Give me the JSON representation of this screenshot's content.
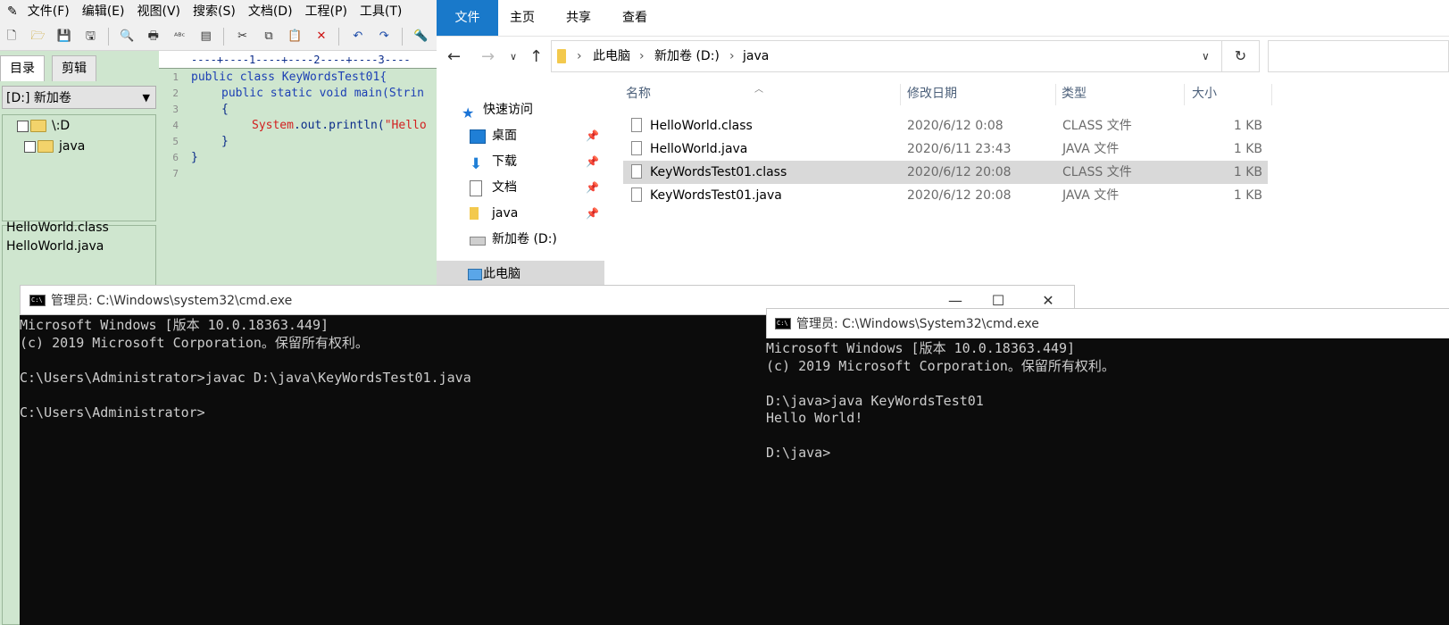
{
  "editor": {
    "menus": [
      "文件(F)",
      "编辑(E)",
      "视图(V)",
      "搜索(S)",
      "文档(D)",
      "工程(P)",
      "工具(T)"
    ],
    "tabs": [
      "目录",
      "剪辑"
    ],
    "drive": "[D:] 新加卷",
    "tree": [
      "\\:D",
      "java"
    ],
    "files": [
      "HelloWorld.class",
      "HelloWorld.java"
    ],
    "ruler": "----+----1----+----2----+----3----",
    "line_numbers": [
      "1",
      "2",
      "3",
      "4",
      "5",
      "6",
      "7"
    ],
    "code": {
      "l1": "public class KeyWordsTest01{",
      "l2_kw": "public static void main(Strin",
      "l3": "{",
      "l4_cls": "System",
      "l4_rest": ".out.println(",
      "l4_str": "\"Hello",
      "l5": "}",
      "l6": "}"
    }
  },
  "explorer": {
    "ribbon_tabs": [
      "文件",
      "主页",
      "共享",
      "查看"
    ],
    "breadcrumb": [
      "此电脑",
      "新加卷 (D:)",
      "java"
    ],
    "nav": [
      {
        "label": "快速访问",
        "icon": "star-icon"
      },
      {
        "label": "桌面",
        "icon": "desktop-icon"
      },
      {
        "label": "下载",
        "icon": "download-icon"
      },
      {
        "label": "文档",
        "icon": "document-icon"
      },
      {
        "label": "java",
        "icon": "folder-icon"
      },
      {
        "label": "新加卷 (D:)",
        "icon": "drive-icon"
      },
      {
        "label": "此电脑",
        "icon": "computer-icon"
      }
    ],
    "columns": [
      "名称",
      "修改日期",
      "类型",
      "大小"
    ],
    "files": [
      {
        "name": "HelloWorld.class",
        "date": "2020/6/12 0:08",
        "type": "CLASS 文件",
        "size": "1 KB"
      },
      {
        "name": "HelloWorld.java",
        "date": "2020/6/11 23:43",
        "type": "JAVA 文件",
        "size": "1 KB"
      },
      {
        "name": "KeyWordsTest01.class",
        "date": "2020/6/12 20:08",
        "type": "CLASS 文件",
        "size": "1 KB"
      },
      {
        "name": "KeyWordsTest01.java",
        "date": "2020/6/12 20:08",
        "type": "JAVA 文件",
        "size": "1 KB"
      }
    ],
    "selected_file": 2
  },
  "cmd1": {
    "title": "管理员: C:\\Windows\\system32\\cmd.exe",
    "lines": [
      "Microsoft Windows [版本 10.0.18363.449]",
      "(c) 2019 Microsoft Corporation。保留所有权利。",
      "",
      "C:\\Users\\Administrator>javac D:\\java\\KeyWordsTest01.java",
      "",
      "C:\\Users\\Administrator>"
    ]
  },
  "cmd2": {
    "title": "管理员: C:\\Windows\\System32\\cmd.exe",
    "lines": [
      "Microsoft Windows [版本 10.0.18363.449]",
      "(c) 2019 Microsoft Corporation。保留所有权利。",
      "",
      "D:\\java>java KeyWordsTest01",
      "Hello World!",
      "",
      "D:\\java>"
    ]
  }
}
